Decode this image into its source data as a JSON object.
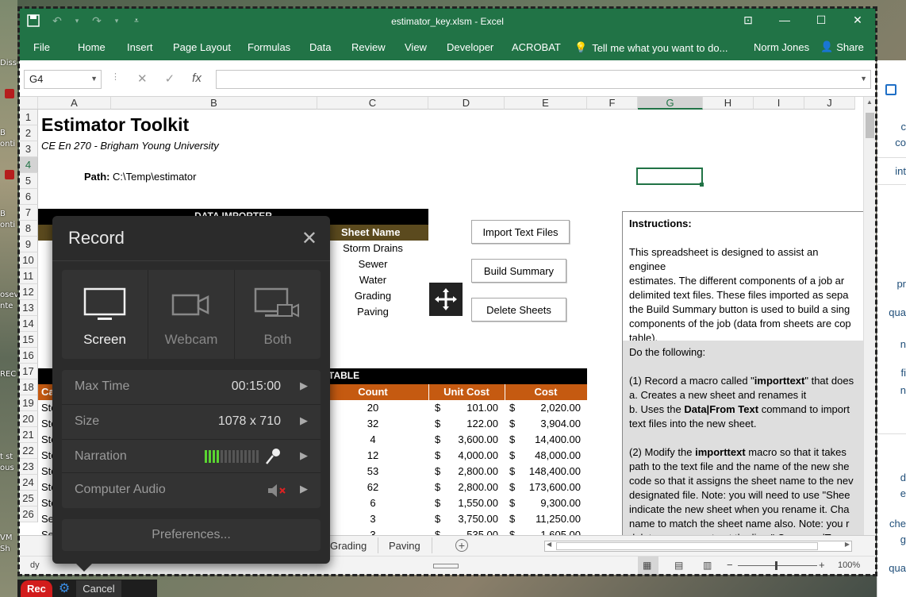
{
  "window": {
    "title": "estimator_key.xlsm - Excel"
  },
  "ribbon": {
    "tabs": [
      "File",
      "Home",
      "Insert",
      "Page Layout",
      "Formulas",
      "Data",
      "Review",
      "View",
      "Developer",
      "ACROBAT"
    ],
    "tell_me": "Tell me what you want to do...",
    "user": "Norm Jones",
    "share": "Share"
  },
  "formula_bar": {
    "name_box": "G4",
    "fx": "fx",
    "content": ""
  },
  "columns": [
    "A",
    "B",
    "C",
    "D",
    "E",
    "F",
    "G",
    "H",
    "I",
    "J"
  ],
  "rows": [
    "1",
    "2",
    "3",
    "4",
    "5",
    "6",
    "7",
    "8",
    "9",
    "10",
    "11",
    "12",
    "13",
    "14",
    "15",
    "16",
    "17",
    "18",
    "19",
    "20",
    "21",
    "22",
    "23",
    "24",
    "25",
    "26"
  ],
  "sheet": {
    "title": "Estimator Toolkit",
    "subtitle": "CE En 270 - Brigham Young University",
    "path_label": "Path:",
    "path_value": "C:\\Temp\\estimator",
    "importer_header": "DATA IMPORTER",
    "sheet_name_header": "Sheet Name",
    "sheet_names": [
      "Storm Drains",
      "Sewer",
      "Water",
      "Grading",
      "Paving"
    ],
    "summary_header_partial": "TABLE",
    "summary_cols": [
      "Count",
      "Unit Cost",
      "Cost"
    ],
    "summary_rows": [
      {
        "a": "Sto",
        "count": "20",
        "unit": "101.00",
        "cost": "2,020.00"
      },
      {
        "a": "Sto",
        "count": "32",
        "unit": "122.00",
        "cost": "3,904.00"
      },
      {
        "a": "Sto",
        "count": "4",
        "unit": "3,600.00",
        "cost": "14,400.00"
      },
      {
        "a": "Sto",
        "count": "12",
        "unit": "4,000.00",
        "cost": "48,000.00"
      },
      {
        "a": "Sto",
        "count": "53",
        "unit": "2,800.00",
        "cost": "148,400.00"
      },
      {
        "a": "Sto",
        "count": "62",
        "unit": "2,800.00",
        "cost": "173,600.00"
      },
      {
        "a": "Sto",
        "count": "6",
        "unit": "1,550.00",
        "cost": "9,300.00"
      },
      {
        "a": "Se",
        "count": "3",
        "unit": "3,750.00",
        "cost": "11,250.00"
      },
      {
        "a": "Se",
        "count": "3",
        "unit": "535.00",
        "cost": "1,605.00"
      }
    ],
    "row17_a": "Ca",
    "currency": "$"
  },
  "buttons": {
    "import": "Import Text Files",
    "build": "Build Summary",
    "delete": "Delete Sheets"
  },
  "instructions": {
    "heading": "Instructions:",
    "p1": [
      "This spreadsheet is designed to assist an enginee",
      "estimates.  The different components of a job ar",
      "delimited text files.  These files imported as sepa",
      "the Build Summary button is used to build a sing",
      "components of the job (data from sheets are cop",
      "table)."
    ],
    "p2": "Do the following:",
    "s1_prefix": "(1) Record a macro called \"",
    "s1_bold": "importtext",
    "s1_suffix": "\" that does",
    "s1_a": "a. Creates a new sheet and renames it",
    "s1_b_prefix": "b. Uses the ",
    "s1_b_bold": "Data|From Text",
    "s1_b_suffix": " command to import",
    "s1_b2": "text files into the new sheet.",
    "s2_prefix": "(2)  Modify the ",
    "s2_bold": "importtext",
    "s2_suffix": " macro so that it takes",
    "s2_lines": [
      "path to the text file and the name of the new she",
      "code so that it assigns the sheet name to the nev",
      "designated file. Note: you will need to use \"Shee",
      "indicate the new sheet when you rename it.  Cha",
      "name to match the sheet name also. Note: you r",
      "delete or comment out the line \".CommandType"
    ]
  },
  "tabs_bar": {
    "tabs": [
      "Grading",
      "Paving"
    ],
    "status_left": "dy",
    "zoom": "100%"
  },
  "record": {
    "title": "Record",
    "sources": [
      "Screen",
      "Webcam",
      "Both"
    ],
    "options": [
      {
        "label": "Max Time",
        "value": "00:15:00"
      },
      {
        "label": "Size",
        "value": "1078 x 710"
      },
      {
        "label": "Narration",
        "value": ""
      },
      {
        "label": "Computer Audio",
        "value": ""
      }
    ],
    "preferences": "Preferences...",
    "rec": "Rec",
    "cancel": "Cancel"
  },
  "desktop": {
    "labels": [
      "Disse",
      "B",
      "onti",
      "B",
      "onti",
      "osev",
      "nte",
      "REC",
      "t st",
      "ous",
      "VM",
      "Sh"
    ]
  },
  "right_panel": {
    "items": [
      "c",
      "co",
      "int",
      "pr",
      "qua",
      "n",
      "fi",
      "n",
      "d",
      "e",
      "che",
      "g",
      "qua"
    ]
  },
  "colors": {
    "excel_green": "#217346",
    "header_black": "#000000",
    "table_orange": "#c55a11",
    "dialog_bg": "#2b2b2b"
  }
}
